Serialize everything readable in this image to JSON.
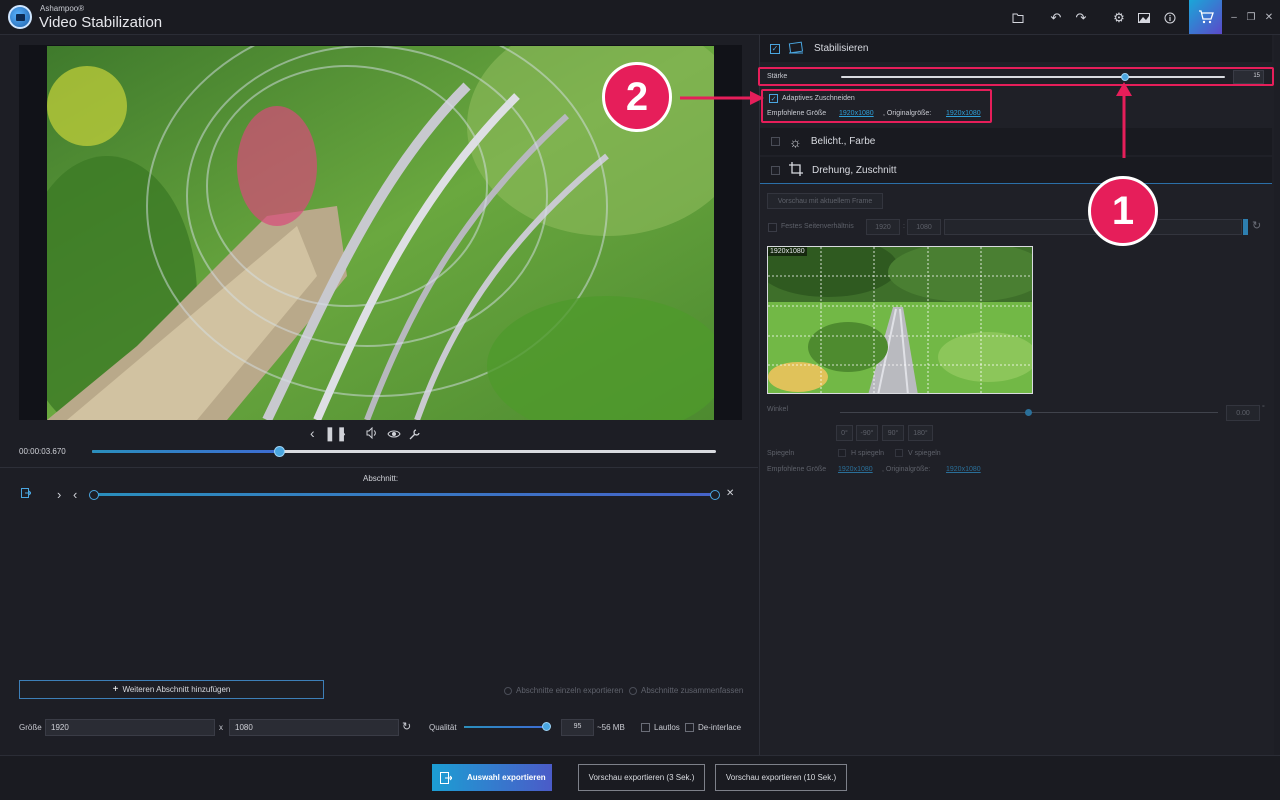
{
  "titlebar": {
    "brand": "Ashampoo®",
    "app_name": "Video Stabilization",
    "icons": [
      "folder-icon",
      "undo-icon",
      "redo-icon",
      "settings-icon",
      "image-icon",
      "info-icon",
      "cart-icon",
      "minimize-icon",
      "restore-icon",
      "close-icon"
    ]
  },
  "player": {
    "time": "00:00:03.670",
    "progress_fraction": 0.3
  },
  "section": {
    "title": "Abschnitt:",
    "add_button": "Weiteren Abschnitt hinzufügen",
    "export_single": "Abschnitte einzeln exportieren",
    "export_merge": "Abschnitte zusammenfassen"
  },
  "output": {
    "size_label": "Größe",
    "width": "1920",
    "x_sep": "x",
    "height": "1080",
    "quality_label": "Qualität",
    "quality_value": "95",
    "quality_fraction": 0.95,
    "size_estimate": "~56 MB",
    "mute_label": "Lautlos",
    "deinterlace_label": "De-interlace"
  },
  "stabilize": {
    "header": "Stabilisieren",
    "strength_label": "Stärke",
    "strength_value": "15",
    "strength_fraction": 0.74,
    "adaptive_crop_label": "Adaptives Zuschneiden",
    "recommended_label": "Empfohlene Größe",
    "recommended_value": "1920x1080",
    "original_label": ", Originalgröße:",
    "original_value": "1920x1080"
  },
  "exposure": {
    "header": "Belicht., Farbe"
  },
  "rotation": {
    "header": "Drehung, Zuschnitt",
    "preview_frame_button": "Vorschau mit aktuellem Frame",
    "fixed_ratio_label": "Festes Seitenverhältnis",
    "ratio_w": "1920",
    "ratio_sep": ":",
    "ratio_h": "1080",
    "thumb_label": "1920x1080",
    "angle_label": "Winkel",
    "angle_value": "0.00",
    "angle_unit": "°",
    "angle_buttons": [
      "0°",
      "-90°",
      "90°",
      "180°"
    ],
    "mirror_label": "Spiegeln",
    "h_mirror": "H spiegeln",
    "v_mirror": "V spiegeln",
    "recommended_label": "Empfohlene Größe",
    "recommended_value": "1920x1080",
    "original_label": ", Originalgröße:",
    "original_value": "1920x1080"
  },
  "bottom": {
    "export_selection": "Auswahl exportieren",
    "preview_3": "Vorschau exportieren (3 Sek.)",
    "preview_10": "Vorschau exportieren (10 Sek.)"
  },
  "annotations": {
    "badge_1": "1",
    "badge_2": "2"
  },
  "colors": {
    "accent": "#2d9fd8",
    "highlight": "#e61e5a",
    "background": "#1d1e25"
  }
}
